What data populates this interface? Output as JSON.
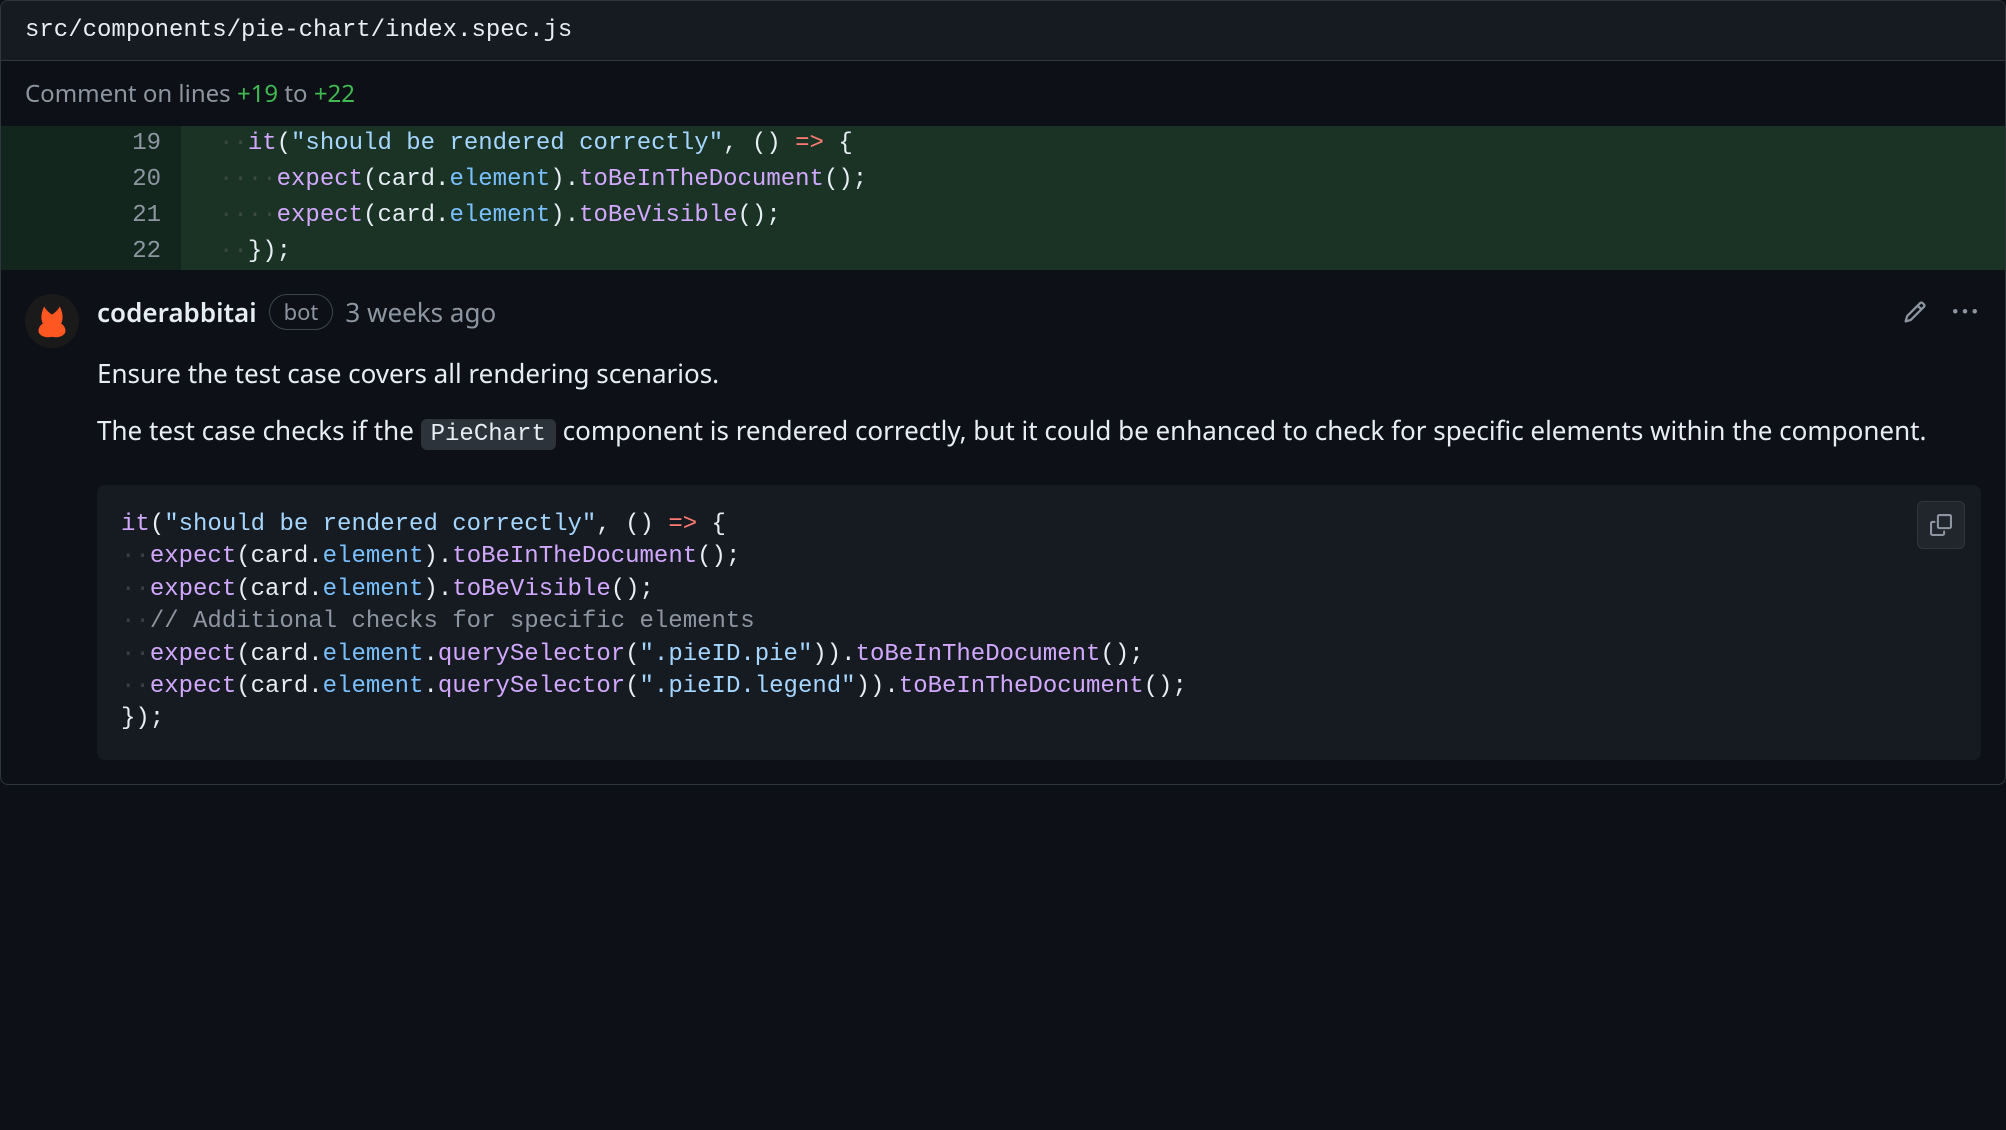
{
  "file": {
    "path": "src/components/pie-chart/index.spec.js"
  },
  "range": {
    "prefix": "Comment on lines",
    "from": "+19",
    "to_word": "to",
    "to": "+22"
  },
  "code": {
    "lines": [
      {
        "num": "19",
        "ws": "··",
        "tokens": "it(\"should be rendered correctly\", () => {"
      },
      {
        "num": "20",
        "ws": "····",
        "tokens": "expect(card.element).toBeInTheDocument();"
      },
      {
        "num": "21",
        "ws": "····",
        "tokens": "expect(card.element).toBeVisible();"
      },
      {
        "num": "22",
        "ws": "··",
        "tokens": "});"
      }
    ]
  },
  "comment": {
    "author": "coderabbitai",
    "badge": "bot",
    "timestamp": "3 weeks ago",
    "paragraph1": "Ensure the test case covers all rendering scenarios.",
    "p2_before": "The test case checks if the ",
    "p2_code": "PieChart",
    "p2_after": " component is rendered correctly, but it could be enhanced to check for specific elements within the component.",
    "suggestion": {
      "line1": {
        "ws": "",
        "text": "it(\"should be rendered correctly\", () => {"
      },
      "line2": {
        "ws": "··",
        "text": "expect(card.element).toBeInTheDocument();"
      },
      "line3": {
        "ws": "··",
        "text": "expect(card.element).toBeVisible();"
      },
      "line4": {
        "ws": "··",
        "text": "// Additional checks for specific elements"
      },
      "line5": {
        "ws": "··",
        "text": "expect(card.element.querySelector(\".pieID.pie\")).toBeInTheDocument();"
      },
      "line6": {
        "ws": "··",
        "text": "expect(card.element.querySelector(\".pieID.legend\")).toBeInTheDocument();"
      },
      "line7": {
        "ws": "",
        "text": "});"
      }
    }
  }
}
